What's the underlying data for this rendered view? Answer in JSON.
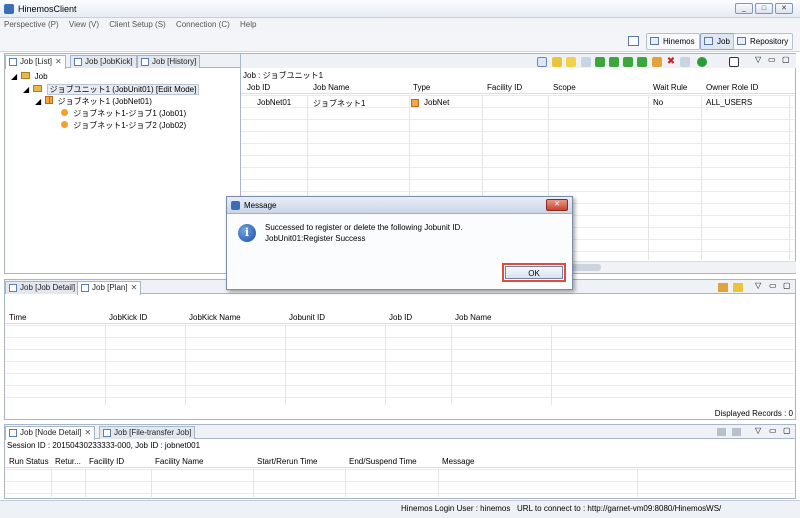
{
  "window": {
    "title": "HinemosClient"
  },
  "menu": [
    "Perspective (P)",
    "View (V)",
    "Client Setup (S)",
    "Connection (C)",
    "Help"
  ],
  "perspectives": [
    {
      "label": "Hinemos"
    },
    {
      "label": "Job",
      "active": true
    },
    {
      "label": "Repository"
    }
  ],
  "top_left": {
    "tabs": [
      "Job [List]",
      "Job [JobKick]",
      "Job [History]"
    ],
    "tree": {
      "root": "Job",
      "unit": "ジョブユニット1 (JobUnit01) [Edit Mode]",
      "net": "ジョブネット1 (JobNet01)",
      "jobs": [
        "ジョブネット1-ジョブ1 (Job01)",
        "ジョブネット1-ジョブ2 (Job02)"
      ]
    }
  },
  "job_table": {
    "title": "Job : ジョブユニット1",
    "columns": [
      "Job ID",
      "Job Name",
      "Type",
      "Facility ID",
      "Scope",
      "Wait Rule",
      "Owner Role ID"
    ],
    "row": {
      "job_id": "JobNet01",
      "job_name": "ジョブネット1",
      "type": "JobNet",
      "facility_id": "",
      "scope": "",
      "wait_rule": "No",
      "owner_role": "ALL_USERS"
    }
  },
  "plan": {
    "tabs": [
      "Job [Job Detail]",
      "Job [Plan]"
    ],
    "columns": [
      "Time",
      "JobKick ID",
      "JobKick Name",
      "Jobunit ID",
      "Job ID",
      "Job Name"
    ],
    "footer": "Displayed Records : 0"
  },
  "node": {
    "tabs": [
      "Job [Node Detail]",
      "Job [File-transfer Job]"
    ],
    "info": "Session ID : 20150430233333-000,   Job ID : jobnet001",
    "columns": [
      "Run Status",
      "Retur...",
      "Facility ID",
      "Facility Name",
      "Start/Rerun Time",
      "End/Suspend Time",
      "Message"
    ]
  },
  "dialog": {
    "title": "Message",
    "line1": "Successed to register or delete the following Jobunit ID.",
    "line2": "JobUnit01:Register Success",
    "ok": "OK"
  },
  "status": {
    "user": "Hinemos Login User : hinemos",
    "url": "URL to connect to : http://garnet-vm09:8080/HinemosWS/"
  },
  "colors": {
    "highlight": "#e34a3a",
    "accent": "#5b7fb3"
  }
}
